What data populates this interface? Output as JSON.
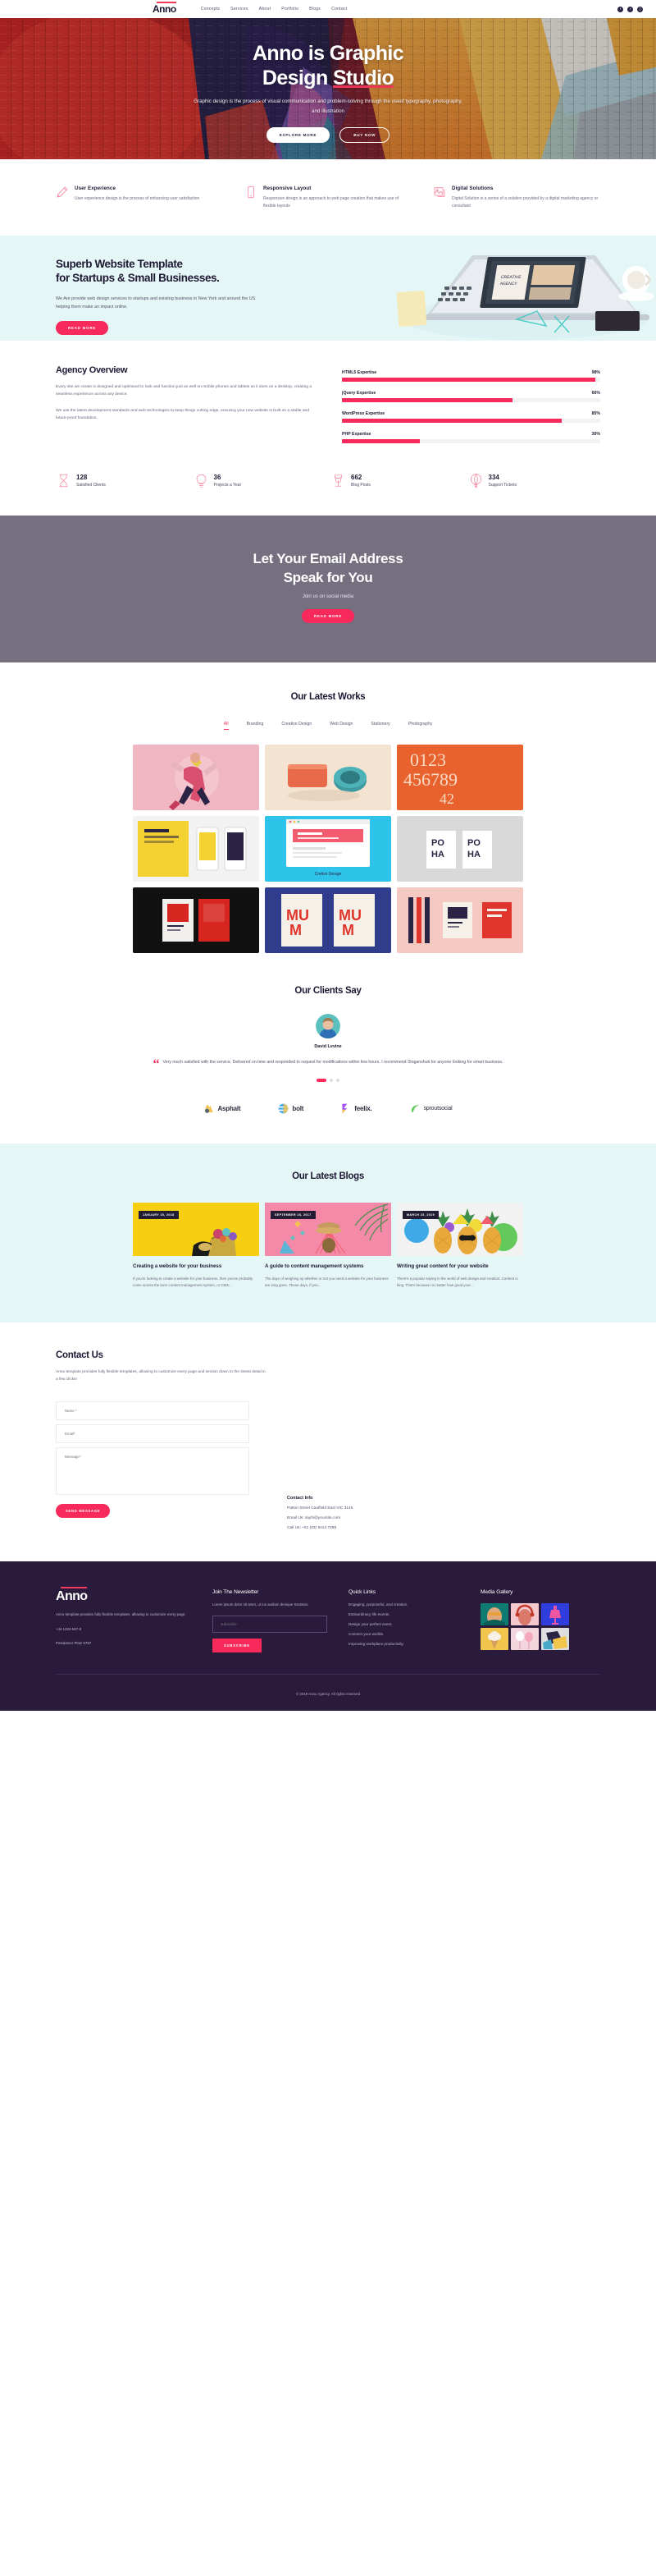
{
  "brand": {
    "name": "Anno",
    "accent": "#f8295b"
  },
  "nav": {
    "logo": "Anno",
    "links": [
      "Concepts",
      "Services",
      "About",
      "Portfolio",
      "Blogs",
      "Contact"
    ],
    "social": [
      "facebook-icon",
      "twitter-icon",
      "instagram-icon"
    ]
  },
  "hero": {
    "title_line1": "Anno is Graphic",
    "title_line2_a": "Design ",
    "title_line2_b": "Studio",
    "subtitle": "Graphic design is the process of visual communication and problem-solving through the useof typography, photography, and illustration",
    "btn_primary": "EXPLORE MORE",
    "btn_secondary": "BUY NOW"
  },
  "features": [
    {
      "icon": "pencil-icon",
      "title": "User Experience",
      "text": "User experience design is the process of enhancing user satisfaction"
    },
    {
      "icon": "tablet-icon",
      "title": "Responsive Layout",
      "text": "Responsive design is an approach to web page creation that makes use of flexible layouts"
    },
    {
      "icon": "image-icon",
      "title": "Digital Solutions",
      "text": "Digital Solution is a series of a solution provided by a digital marketing agency or consultant"
    }
  ],
  "template_banner": {
    "title_line1": "Superb Website Template",
    "title_line2": "for Startups & Small Businesses.",
    "text": "We Are provide web design services to startups and existing business in New York and around the US helping them make an impact online.",
    "button": "READ MORE"
  },
  "agency": {
    "title": "Agency Overview",
    "para1": "Every site we create is designed and optimised to look and function just as well on mobile phones and tablets as it does on a desktop, creating a seamless experience across any device.",
    "para2": "We use the latest development standards and web technologies to keep things cutting edge, ensuring your new website is built on a stable and future-proof foundation."
  },
  "chart_data": {
    "type": "bar",
    "title": "Agency Overview skill bars",
    "categories": [
      "HTML5 Expertise",
      "jQuery Expertise",
      "WordPress Expertise",
      "PHP Expertise"
    ],
    "values": [
      98,
      66,
      85,
      30
    ],
    "value_labels": [
      "98%",
      "66%",
      "85%",
      "30%"
    ],
    "xlabel": "",
    "ylabel": "",
    "ylim": [
      0,
      100
    ],
    "orientation": "horizontal",
    "bar_color": "#f8295b",
    "track_color": "#f2f2f4",
    "grid": false,
    "legend": "none"
  },
  "counters": [
    {
      "icon": "hourglass-icon",
      "number": "128",
      "label": "Satisfied Clients"
    },
    {
      "icon": "bulb-icon",
      "number": "36",
      "label": "Projects a Year"
    },
    {
      "icon": "glass-icon",
      "number": "662",
      "label": "Blog Posts"
    },
    {
      "icon": "balloon-icon",
      "number": "334",
      "label": "Support Tickets"
    }
  ],
  "email_cta": {
    "title_line1": "Let Your Email Address",
    "title_line2": "Speak for You",
    "subtitle": "Join us on social media",
    "button": "READ MORE"
  },
  "works": {
    "title": "Our Latest Works",
    "filters": [
      "All",
      "Branding",
      "Creative Design",
      "Web Design",
      "Stationery",
      "Photography"
    ],
    "active_filter": "All",
    "items": [
      {
        "name": "pink-dancer-poster",
        "caption": ""
      },
      {
        "name": "beige-sponge-product",
        "caption": ""
      },
      {
        "name": "orange-numerals-poster",
        "caption": "0123 456789 42"
      },
      {
        "name": "yellow-mobile-mockup",
        "caption": ""
      },
      {
        "name": "creative-design-browser-mockup",
        "caption": "Cretive Design"
      },
      {
        "name": "grey-poha-books",
        "caption": "PO HA"
      },
      {
        "name": "black-red-book-cover",
        "caption": ""
      },
      {
        "name": "blue-mum-poster",
        "caption": "MU M"
      },
      {
        "name": "pink-stationery-set",
        "caption": ""
      }
    ]
  },
  "clients": {
    "title": "Our Clients Say",
    "avatar": "client-avatar",
    "name": "David Levine",
    "quote": "Very much satisfied with the service. Delivered on time and responded to request for modifications within few hours. I recommend Sloganshub for anyone looking for smart business.",
    "dots": 3,
    "active_dot": 0,
    "logos": [
      "Asphalt",
      "bolt",
      "feelix.",
      "sproutsocial"
    ]
  },
  "blogs": {
    "title": "Our Latest Blogs",
    "posts": [
      {
        "date": "JANUARY 15, 2018",
        "title": "Creating a website for your business",
        "excerpt": "If you're looking to create a website for your business, then you've probably come across the term content management system, or CMS...",
        "image": "yellow-flower-basket"
      },
      {
        "date": "SEPTEMBER 28, 2017",
        "title": "A guide to content management systems",
        "excerpt": "The days of weighing up whether or not you need a website for your business are long gone. These days, if you...",
        "image": "pink-hat-fan"
      },
      {
        "date": "MARCH 23, 2019",
        "title": "Writing great content for your website",
        "excerpt": "There's a popular saying in the world of web design and creation: Content is king. That's because no matter how good your...",
        "image": "pineapple-party"
      }
    ]
  },
  "contact": {
    "title": "Contact Us",
    "lead": "Anno template provides fully flexible templates, allowing to customize every page and section down to the tiniest detail in a few clicks!",
    "name_placeholder": "Name *",
    "email_placeholder": "Email*",
    "message_placeholder": "Message*",
    "submit": "SEND MESSAGE",
    "info_title": "Contact Info",
    "address": "Patton Street Caulfield East VIC 3145",
    "email": "Email Us: sayhi@yoursite.com",
    "phone": "Call Us: +61 (03) 9414 7288"
  },
  "footer": {
    "logo": "Anno",
    "about": "Anno template provides fully flexible templates, allowing to customize every page.",
    "phone": "+44 1234-567-8",
    "address": "Potsdamer Platz 9797",
    "newsletter_title": "Join The Newsletter",
    "newsletter_text": "Lorem ipsum dolor sit amet, ut ius audiam denique tractatos.",
    "newsletter_placeholder": "subscribe",
    "newsletter_button": "SUBSCRIBE",
    "quick_links_title": "Quick Links",
    "quick_links": [
      "Engaging, purposeful, and creative.",
      "Extraordinary life events.",
      "Design your perfect event.",
      "Connect your worlds.",
      "Improving workplace productivity."
    ],
    "media_title": "Media Gallery",
    "media": [
      "teal-portrait",
      "pink-headphones",
      "blue-lamp",
      "yellow-icecream",
      "pink-balloons",
      "grey-abstract"
    ],
    "copyright": "© 2019 Anno Agency. All rights reserved"
  }
}
